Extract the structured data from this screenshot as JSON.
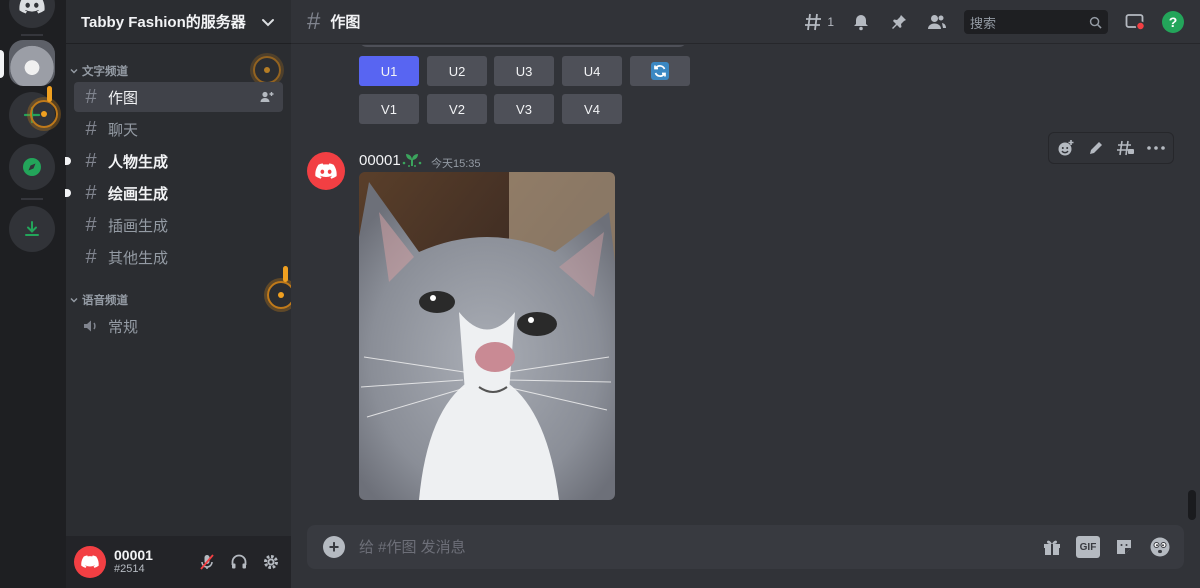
{
  "server": {
    "name": "Tabby Fashion的服务器"
  },
  "categories": {
    "text": "文字频道",
    "voice": "语音频道"
  },
  "channels": [
    {
      "name": "作图",
      "state": "active"
    },
    {
      "name": "聊天",
      "state": "normal"
    },
    {
      "name": "人物生成",
      "state": "unread"
    },
    {
      "name": "绘画生成",
      "state": "unread"
    },
    {
      "name": "插画生成",
      "state": "normal"
    },
    {
      "name": "其他生成",
      "state": "normal"
    }
  ],
  "voice_channels": [
    {
      "name": "常规"
    }
  ],
  "user": {
    "name": "00001",
    "tag": "#2514"
  },
  "topbar": {
    "channel": "作图",
    "thread_count": "1",
    "search_placeholder": "搜索"
  },
  "buttons": {
    "upscale": [
      "U1",
      "U2",
      "U3",
      "U4"
    ],
    "variation": [
      "V1",
      "V2",
      "V3",
      "V4"
    ]
  },
  "message": {
    "author": "00001",
    "time": "今天15:35"
  },
  "composer": {
    "placeholder": "给 #作图 发消息",
    "gif_label": "GIF"
  },
  "colors": {
    "accent": "#5865f2",
    "danger": "#f23f43",
    "success": "#23a55a",
    "warning": "#f0a020"
  }
}
